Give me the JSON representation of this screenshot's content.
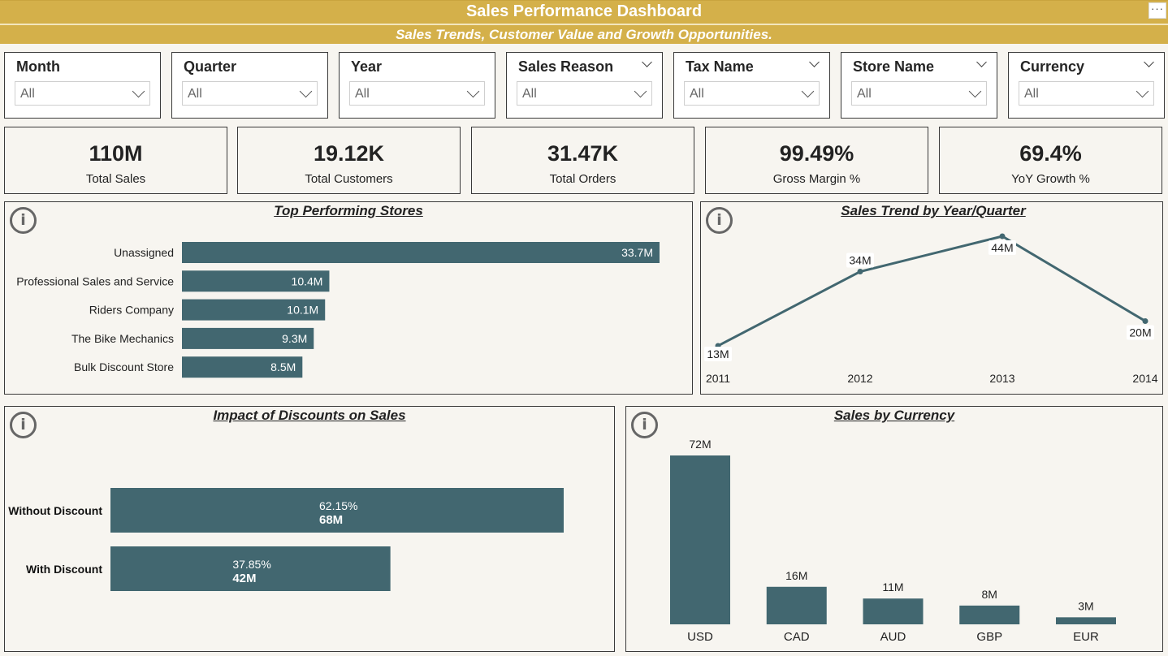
{
  "header": {
    "title": "Sales Performance Dashboard",
    "subtitle": "Sales Trends, Customer Value and Growth Opportunities.",
    "menu": "···"
  },
  "filters": [
    {
      "label": "Month",
      "value": "All",
      "show_caret": false
    },
    {
      "label": "Quarter",
      "value": "All",
      "show_caret": false
    },
    {
      "label": "Year",
      "value": "All",
      "show_caret": false
    },
    {
      "label": "Sales Reason",
      "value": "All",
      "show_caret": true
    },
    {
      "label": "Tax Name",
      "value": "All",
      "show_caret": true
    },
    {
      "label": "Store Name",
      "value": "All",
      "show_caret": true
    },
    {
      "label": "Currency",
      "value": "All",
      "show_caret": true
    }
  ],
  "kpis": [
    {
      "value": "110M",
      "caption": "Total Sales"
    },
    {
      "value": "19.12K",
      "caption": "Total Customers"
    },
    {
      "value": "31.47K",
      "caption": "Total Orders"
    },
    {
      "value": "99.49%",
      "caption": "Gross Margin %"
    },
    {
      "value": "69.4%",
      "caption": "YoY Growth %"
    }
  ],
  "colors": {
    "bar": "#426770",
    "header": "#d4b04a",
    "background": "#f7f5f0"
  },
  "icons": {
    "info": "info-circle-icon",
    "menu": "more-options-icon"
  },
  "chart_data": [
    {
      "id": "stores",
      "type": "bar",
      "orientation": "horizontal",
      "title": "Top Performing Stores",
      "categories": [
        "Unassigned",
        "Professional Sales and Service",
        "Riders Company",
        "The Bike Mechanics",
        "Bulk Discount Store"
      ],
      "values": [
        33.7,
        10.4,
        10.1,
        9.3,
        8.5
      ],
      "labels": [
        "33.7M",
        "10.4M",
        "10.1M",
        "9.3M",
        "8.5M"
      ],
      "unit": "M"
    },
    {
      "id": "trend",
      "type": "line",
      "title": "Sales Trend by Year/Quarter",
      "x": [
        "2011",
        "2012",
        "2013",
        "2014"
      ],
      "values": [
        13,
        34,
        44,
        20
      ],
      "labels": [
        "13M",
        "34M",
        "44M",
        "20M"
      ],
      "unit": "M"
    },
    {
      "id": "discounts",
      "type": "bar",
      "orientation": "horizontal",
      "title": "Impact of Discounts on Sales",
      "categories": [
        "Without Discount",
        "With Discount"
      ],
      "values": [
        68,
        42
      ],
      "percent_labels": [
        "62.15%",
        "37.85%"
      ],
      "value_labels": [
        "68M",
        "42M"
      ],
      "unit": "M"
    },
    {
      "id": "currency",
      "type": "bar",
      "orientation": "vertical",
      "title": "Sales by Currency",
      "categories": [
        "USD",
        "CAD",
        "AUD",
        "GBP",
        "EUR"
      ],
      "values": [
        72,
        16,
        11,
        8,
        3
      ],
      "labels": [
        "72M",
        "16M",
        "11M",
        "8M",
        "3M"
      ],
      "unit": "M"
    }
  ]
}
